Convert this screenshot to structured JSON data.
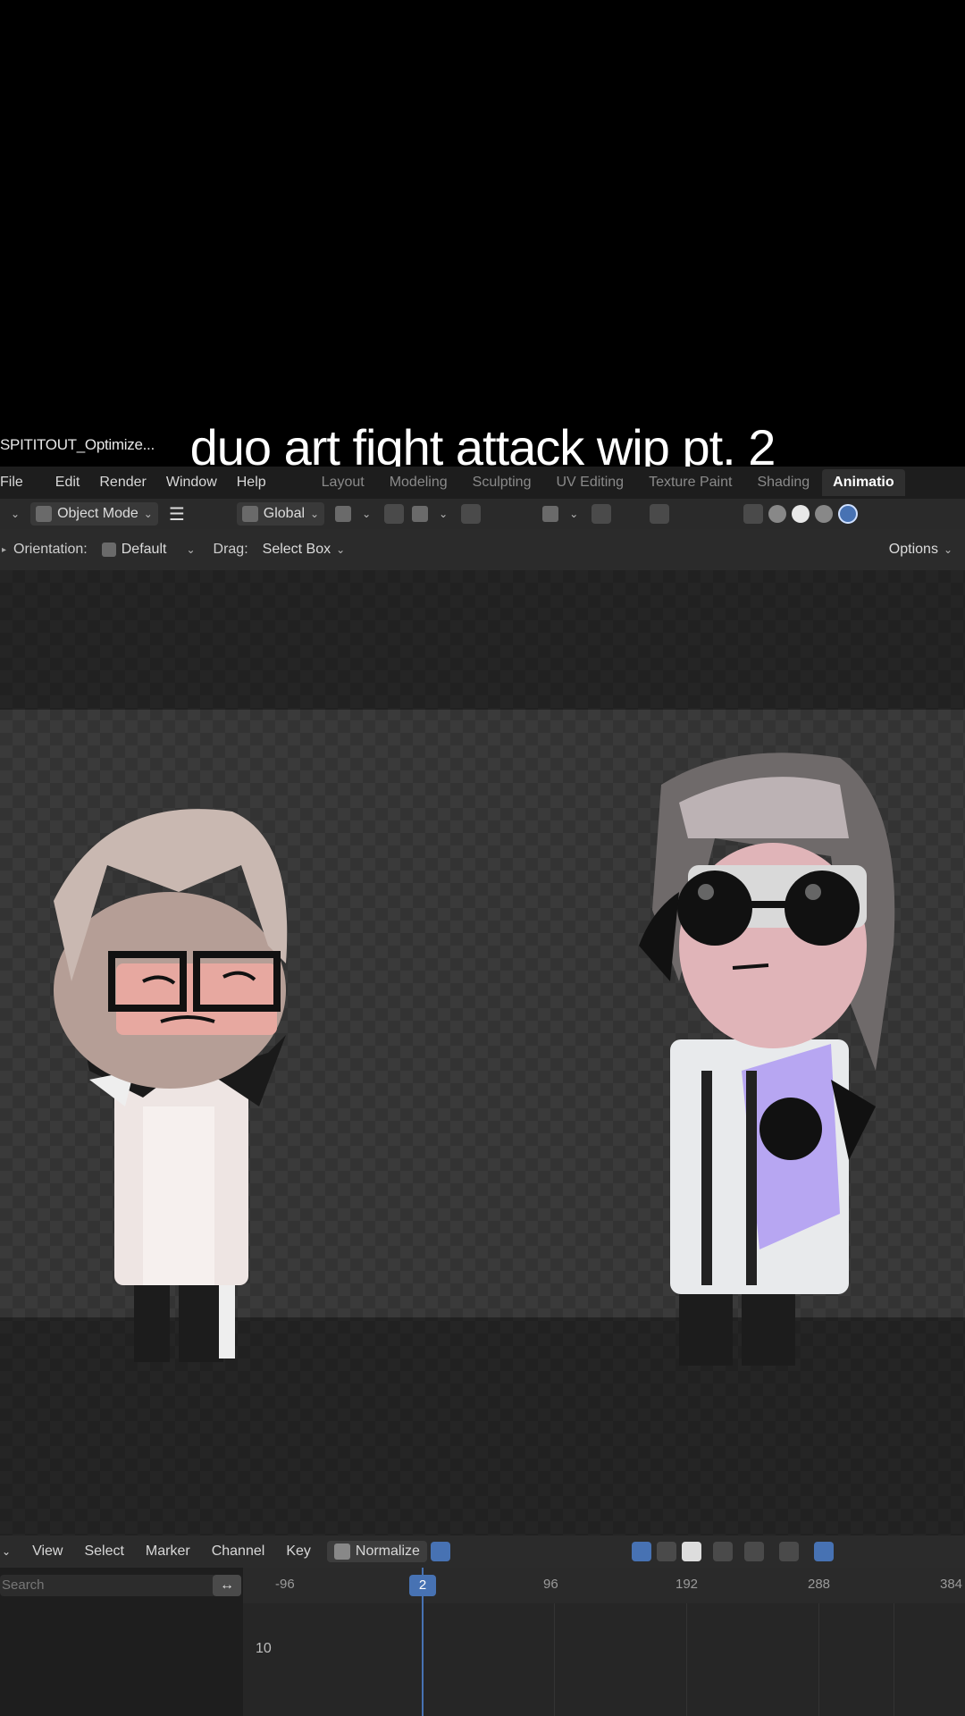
{
  "caption": "duo art fight attack wip pt. 2",
  "window": {
    "file_name": "SPITITOUT_Optimize..."
  },
  "menubar": {
    "menus": [
      "File",
      "Edit",
      "Render",
      "Window",
      "Help"
    ],
    "workspaces": [
      "Layout",
      "Modeling",
      "Sculpting",
      "UV Editing",
      "Texture Paint",
      "Shading",
      "Animatio"
    ]
  },
  "header": {
    "mode": "Object Mode",
    "transform_orientation": "Global"
  },
  "tool_settings": {
    "orientation_label": "Orientation:",
    "orientation_value": "Default",
    "drag_label": "Drag:",
    "drag_value": "Select Box",
    "options": "Options"
  },
  "timeline": {
    "menus": [
      "View",
      "Select",
      "Marker",
      "Channel",
      "Key"
    ],
    "normalize": "Normalize",
    "search_placeholder": "Search",
    "current_frame": "2",
    "ruler_ticks": [
      "-96",
      "96",
      "192",
      "288",
      "384"
    ],
    "y_label": "10"
  },
  "colors": {
    "accent": "#4772b3",
    "background": "#000000"
  }
}
